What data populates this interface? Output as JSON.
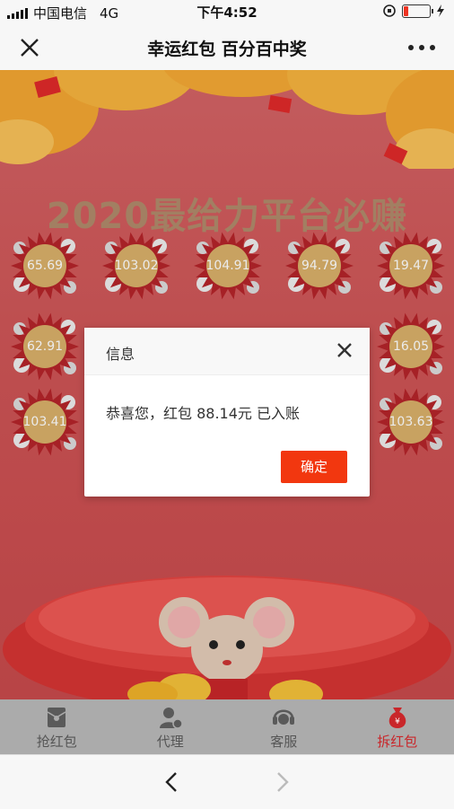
{
  "status_bar": {
    "carrier": "中国电信",
    "network": "4G",
    "time": "下午4:52"
  },
  "titlebar": {
    "title": "幸运红包 百分百中奖"
  },
  "banner": {
    "headline": "2020最给力平台必赚"
  },
  "bursts": [
    "65.69",
    "103.02",
    "104.91",
    "94.79",
    "19.47",
    "62.91",
    "16.05",
    "103.41",
    "103.63"
  ],
  "dialog": {
    "title": "信息",
    "message": "恭喜您，红包 88.14元 已入账",
    "ok_label": "确定"
  },
  "tabs": [
    {
      "label": "抢红包",
      "icon": "red-envelope-icon"
    },
    {
      "label": "代理",
      "icon": "agent-icon"
    },
    {
      "label": "客服",
      "icon": "customer-service-icon"
    },
    {
      "label": "拆红包",
      "icon": "money-bag-icon"
    }
  ],
  "colors": {
    "accent": "#f2370f",
    "active_tab": "#c9262a",
    "background": "#cf5657"
  }
}
